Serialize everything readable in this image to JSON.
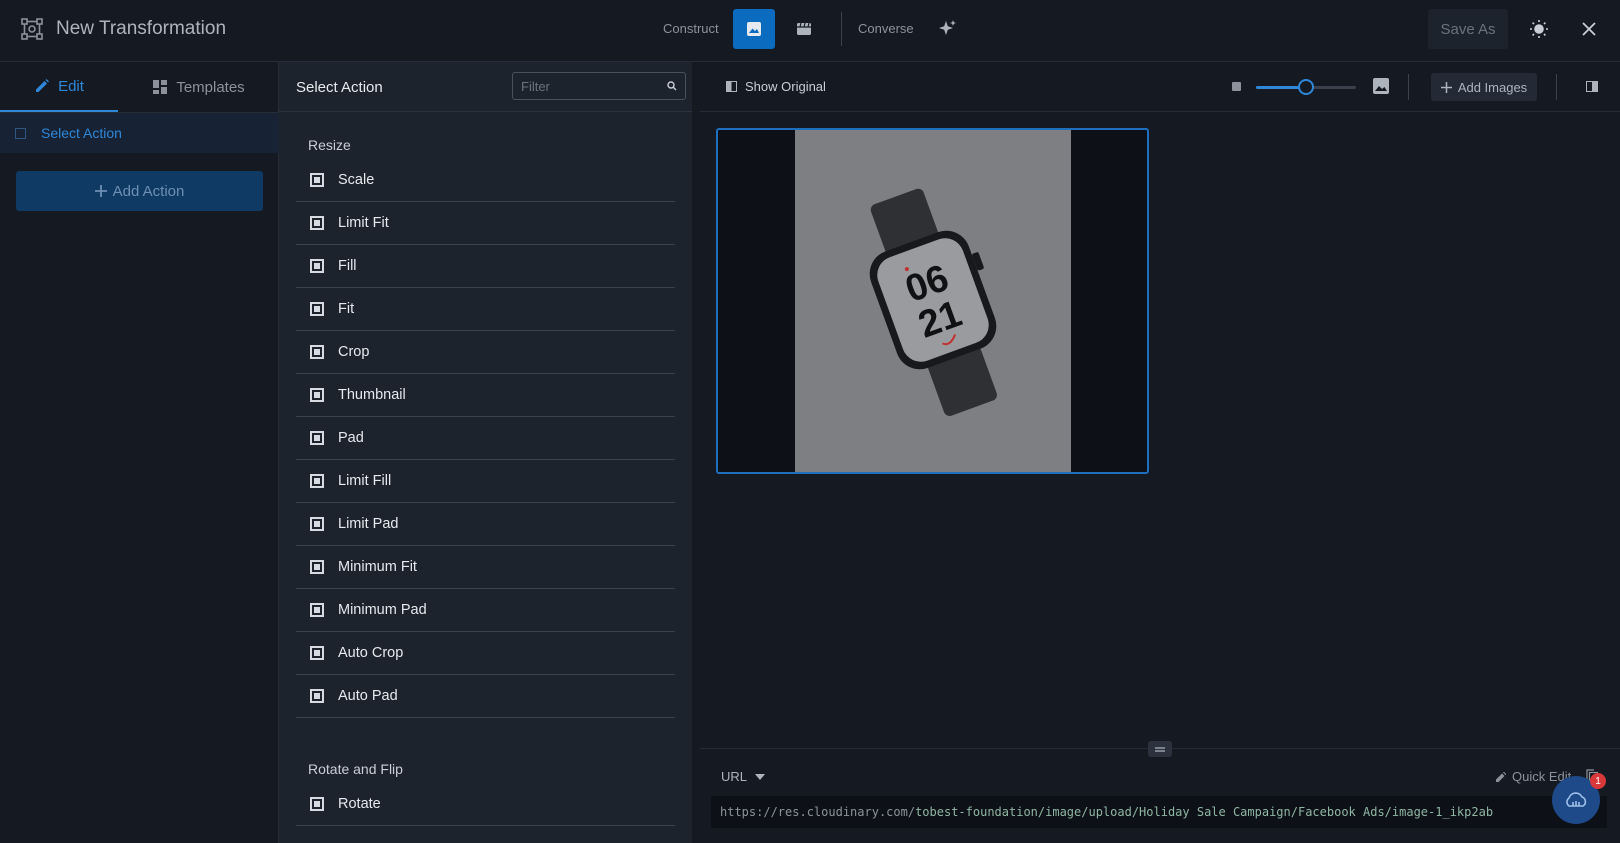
{
  "app": {
    "title": "New Transformation"
  },
  "modes": {
    "construct_label": "Construct",
    "converse_label": "Converse"
  },
  "header": {
    "save_as_label": "Save As"
  },
  "left_panel": {
    "tabs": [
      {
        "label": "Edit"
      },
      {
        "label": "Templates"
      }
    ],
    "select_action_label": "Select Action",
    "add_action_label": "Add Action"
  },
  "action_panel": {
    "title": "Select Action",
    "filter_placeholder": "Filter",
    "sections": [
      {
        "title": "Resize",
        "items": [
          "Scale",
          "Limit Fit",
          "Fill",
          "Fit",
          "Crop",
          "Thumbnail",
          "Pad",
          "Limit Fill",
          "Limit Pad",
          "Minimum Fit",
          "Minimum Pad",
          "Auto Crop",
          "Auto Pad"
        ]
      },
      {
        "title": "Rotate and Flip",
        "items": [
          "Rotate"
        ]
      }
    ]
  },
  "preview": {
    "show_original_label": "Show Original",
    "zoom_fraction": 0.5,
    "add_images_label": "Add Images",
    "watch_face": {
      "line1": "06",
      "line2": "21"
    }
  },
  "bottom": {
    "url_mode_label": "URL",
    "quick_edit_label": "Quick Edit",
    "url_base": "https://res.cloudinary.com/",
    "url_path": "tobest-foundation/image/upload/Holiday Sale Campaign/Facebook Ads/image-1_ikp2ab"
  },
  "chat": {
    "badge_count": "1"
  },
  "colors": {
    "accent": "#2f87d8",
    "active_mode": "#0a6bbf",
    "panel_bg": "#1d232d",
    "app_bg": "#151a22"
  },
  "icons": [
    "transform-logo-icon",
    "image-icon",
    "video-icon",
    "sparkle-icon",
    "sun-icon",
    "close-icon",
    "pencil-icon",
    "grid-icon",
    "search-icon",
    "compare-icon",
    "image-small-icon",
    "image-large-icon",
    "plus-icon",
    "panel-toggle-icon",
    "chevron-down-icon",
    "copy-icon",
    "chat-icon"
  ]
}
